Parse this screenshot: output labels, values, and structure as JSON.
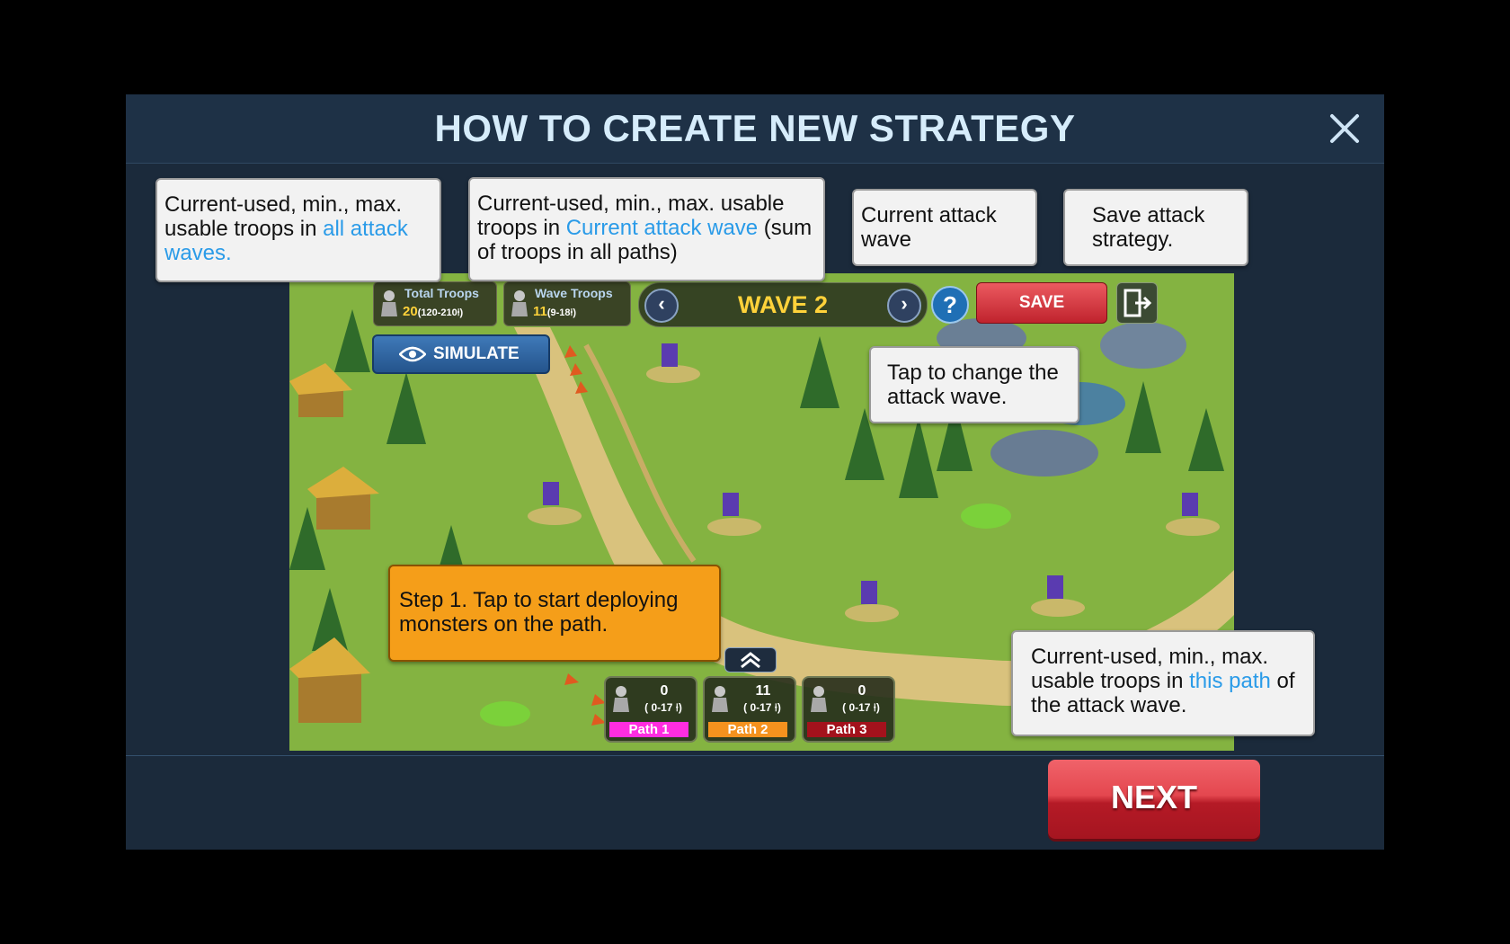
{
  "dialog": {
    "title": "HOW TO CREATE NEW STRATEGY",
    "next_label": "NEXT"
  },
  "hud": {
    "total_troops_label": "Total Troops",
    "total_troops_value": "20",
    "total_troops_range": "(120-210",
    "wave_troops_label": "Wave Troops",
    "wave_troops_value": "11",
    "wave_troops_range": "(9-18",
    "wave_label": "WAVE 2",
    "prev_symbol": "‹",
    "next_symbol": "›",
    "help_symbol": "?",
    "save_label": "SAVE",
    "simulate_label": "SIMULATE"
  },
  "paths": [
    {
      "count": "0",
      "range": "( 0-17",
      "label": "Path 1",
      "color": "#ff2de0"
    },
    {
      "count": "11",
      "range": "( 0-17",
      "label": "Path 2",
      "color": "#f5921e"
    },
    {
      "count": "0",
      "range": "( 0-17",
      "label": "Path 3",
      "color": "#a3121c"
    }
  ],
  "callouts": {
    "total": {
      "pre": "Current-used, min., max. usable troops in ",
      "hl": "all attack waves.",
      "post": ""
    },
    "wave": {
      "pre": "Current-used, min., max. usable troops in ",
      "hl": "Current attack wave",
      "post": " (sum of troops in all paths)"
    },
    "current_wave": {
      "text": "Current attack wave"
    },
    "save": {
      "text": "Save attack strategy."
    },
    "tap_change": {
      "text": "Tap to change the attack wave."
    },
    "step1": {
      "text": "Step 1. Tap to start deploying monsters on the path."
    },
    "path": {
      "pre": "Current-used, min., max. usable troops in ",
      "hl": "this path",
      "post": " of the attack wave."
    }
  },
  "colors": {
    "modal_bg": "#1b2a3b",
    "title": "#d6ecfb",
    "highlight": "#2a9be8",
    "wave_text": "#ffd23a",
    "save_red": "#c0232d",
    "next_red": "#e4474f",
    "step_orange": "#f59e19"
  }
}
